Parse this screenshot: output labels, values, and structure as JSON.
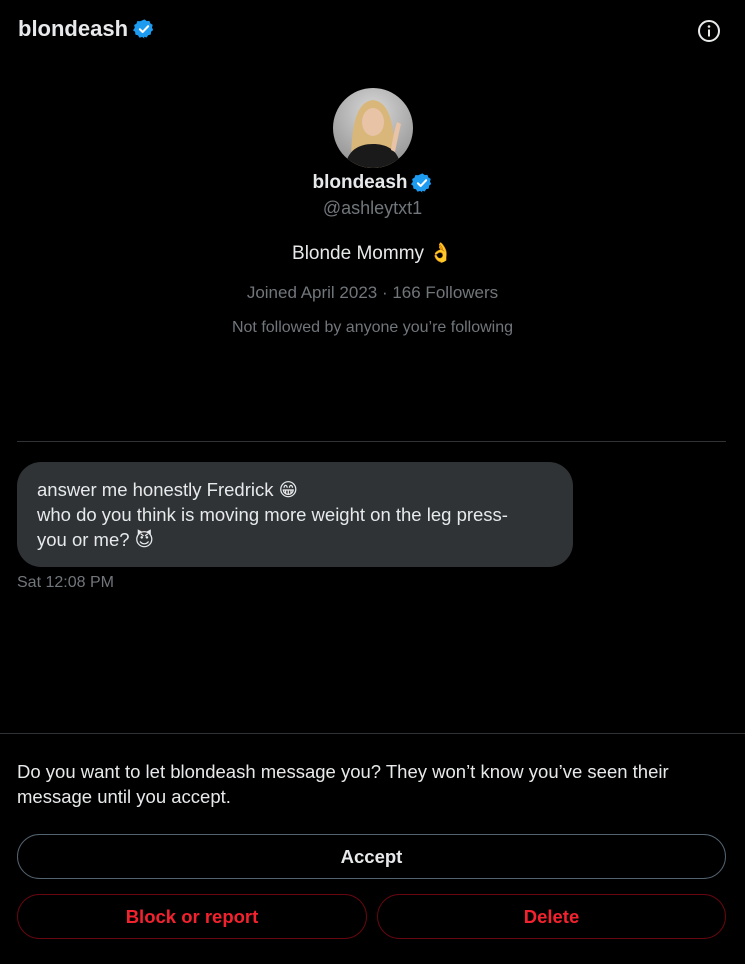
{
  "header": {
    "title": "blondeash",
    "info_icon": "info-circle-icon"
  },
  "profile": {
    "name": "blondeash",
    "handle": "@ashleytxt1",
    "bio": "Blonde Mommy 👌",
    "meta": "Joined April 2023 · 166 Followers",
    "note": "Not followed by anyone you’re following"
  },
  "message": {
    "lines": [
      "answer me honestly  Fredrick  😁",
      "who do you think is moving more weight on the leg press-",
      "you or me? 😈"
    ],
    "time": "Sat 12:08 PM"
  },
  "request": {
    "prompt": "Do you want to let blondeash message you? They won’t know you’ve seen their message until you accept.",
    "accept_label": "Accept",
    "block_label": "Block or report",
    "delete_label": "Delete"
  },
  "colors": {
    "background": "#000000",
    "verified": "#1d9bf0",
    "bubble": "#2f3336",
    "muted_text": "#71767b",
    "danger": "#f4212e"
  }
}
